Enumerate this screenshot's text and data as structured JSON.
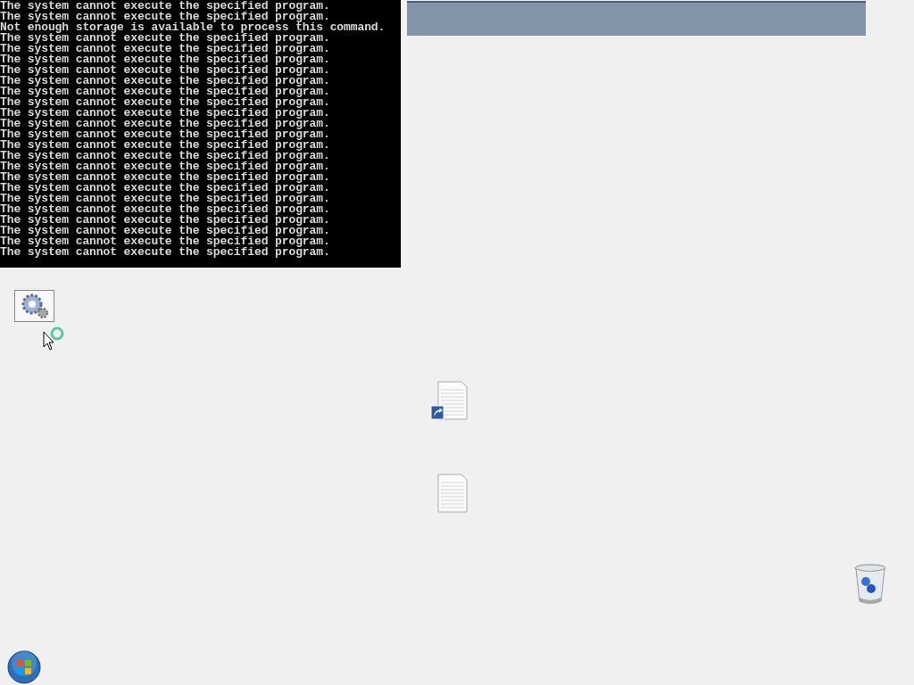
{
  "console": {
    "lines": [
      "The system cannot execute the specified program.",
      "The system cannot execute the specified program.",
      "Not enough storage is available to process this command.",
      "The system cannot execute the specified program.",
      "The system cannot execute the specified program.",
      "The system cannot execute the specified program.",
      "The system cannot execute the specified program.",
      "The system cannot execute the specified program.",
      "The system cannot execute the specified program.",
      "The system cannot execute the specified program.",
      "The system cannot execute the specified program.",
      "The system cannot execute the specified program.",
      "The system cannot execute the specified program.",
      "The system cannot execute the specified program.",
      "The system cannot execute the specified program.",
      "The system cannot execute the specified program.",
      "The system cannot execute the specified program.",
      "The system cannot execute the specified program.",
      "The system cannot execute the specified program.",
      "The system cannot execute the specified program.",
      "The system cannot execute the specified program.",
      "The system cannot execute the specified program.",
      "The system cannot execute the specified program.",
      "The system cannot execute the specified program."
    ]
  }
}
